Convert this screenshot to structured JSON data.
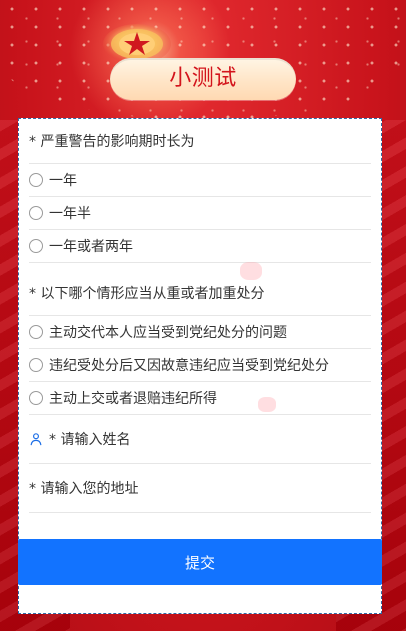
{
  "header": {
    "title": "小测试"
  },
  "questions": [
    {
      "title": "* 严重警告的影响期时长为",
      "options": [
        "一年",
        "一年半",
        "一年或者两年"
      ]
    },
    {
      "title": "* 以下哪个情形应当从重或者加重处分",
      "options": [
        "主动交代本人应当受到党纪处分的问题",
        "违纪受处分后又因故意违纪应当受到党纪处分",
        "主动上交或者退赔违纪所得"
      ]
    }
  ],
  "fields": {
    "name_placeholder": "* 请输入姓名",
    "address_placeholder": "* 请输入您的地址"
  },
  "actions": {
    "submit_label": "提交"
  },
  "colors": {
    "accent": "#1273ff",
    "brand_red": "#c8131b",
    "title_red": "#d3141c"
  }
}
